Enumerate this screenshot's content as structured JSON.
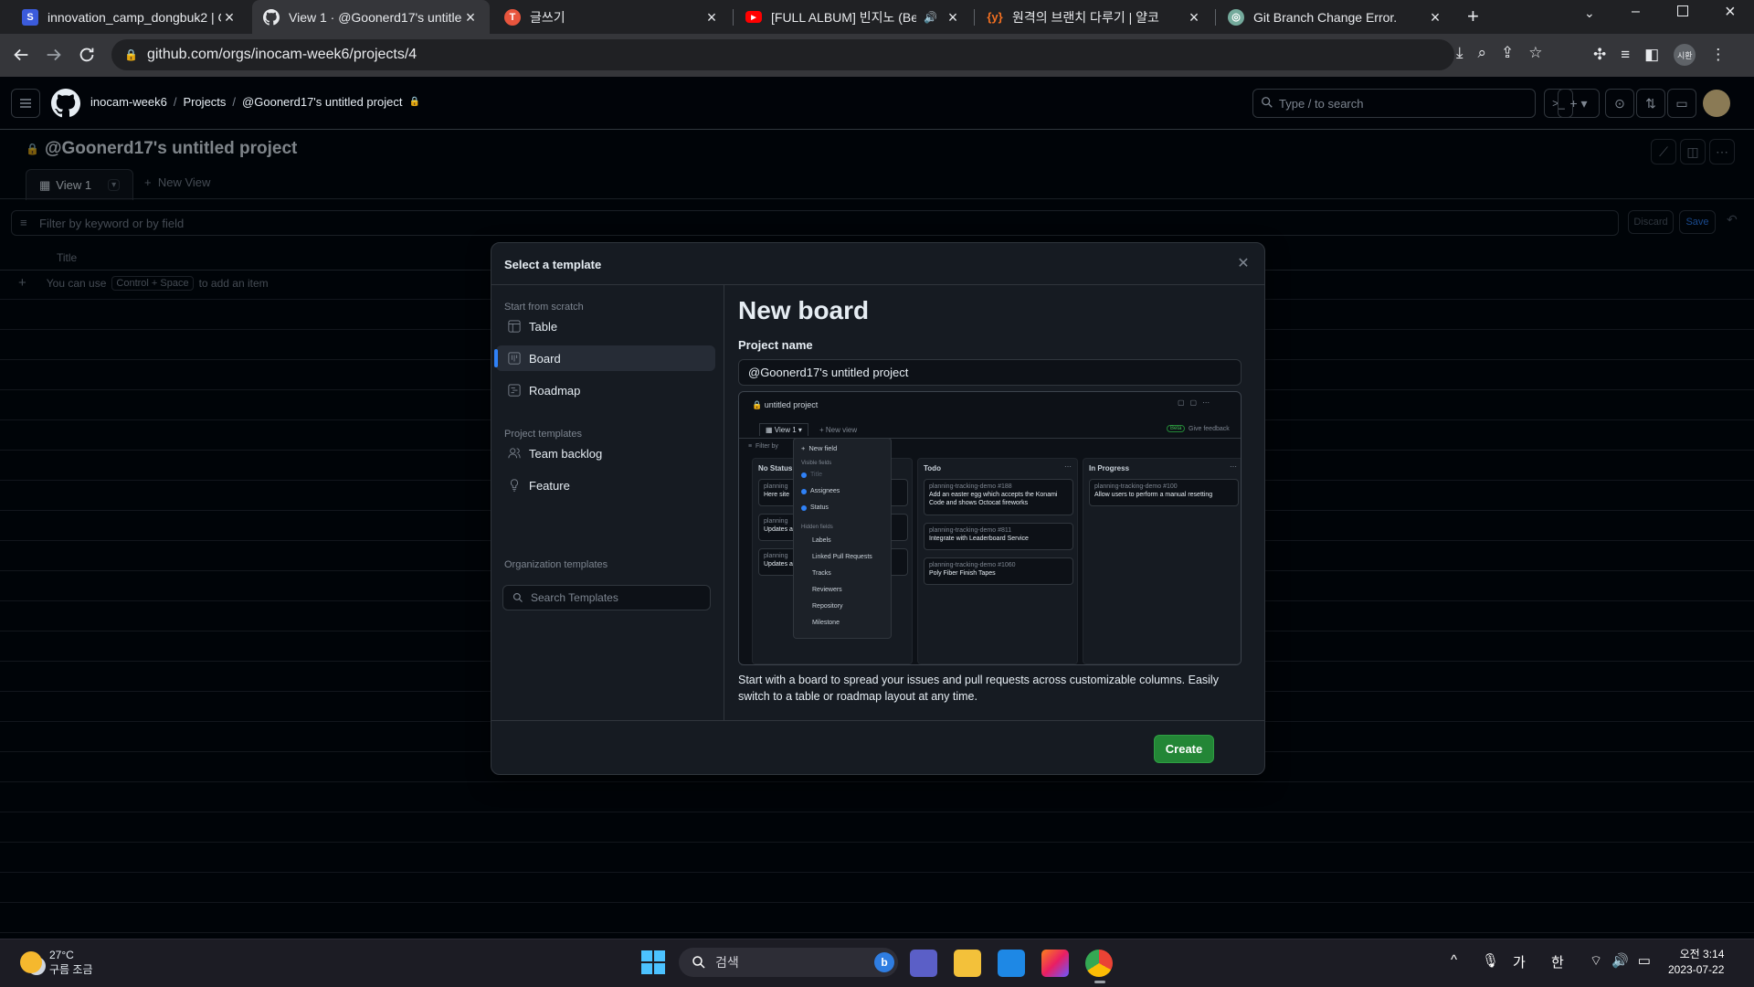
{
  "browser": {
    "tabs": [
      {
        "title": "innovation_camp_dongbuk2 | G",
        "icon": "brand-square-icon",
        "color": "#3b5bdb"
      },
      {
        "title": "View 1 · @Goonerd17's untitled",
        "icon": "github-icon",
        "active": true
      },
      {
        "title": "글쓰기",
        "icon": "tistory-icon",
        "color": "#e8553d"
      },
      {
        "title": "[FULL ALBUM] 빈지노 (Been",
        "icon": "youtube-icon",
        "color": "#ff0000"
      },
      {
        "title": "원격의 브랜치 다루기 | 얄코",
        "icon": "yalco-icon",
        "color": "#f37021"
      },
      {
        "title": "Git Branch Change Error.",
        "icon": "chatgpt-icon",
        "color": "#74aa9c"
      }
    ],
    "url": "github.com/orgs/inocam-week6/projects/4"
  },
  "github": {
    "breadcrumb": [
      "inocam-week6",
      "Projects",
      "@Goonerd17's untitled project"
    ],
    "search_placeholder": "Type / to search",
    "project_title": "@Goonerd17's untitled project",
    "view_tab": "View 1",
    "new_view": "New View",
    "filter_placeholder": "Filter by keyword or by field",
    "discard": "Discard",
    "save": "Save",
    "column_title": "Title",
    "add_hint_pre": "You can use",
    "add_hint_key": "Control + Space",
    "add_hint_post": "to add an item"
  },
  "dialog": {
    "heading": "Select a template",
    "sections": {
      "scratch": "Start from scratch",
      "project_templates": "Project templates",
      "org_templates": "Organization templates"
    },
    "scratch_items": [
      {
        "label": "Table",
        "icon": "table-icon"
      },
      {
        "label": "Board",
        "icon": "board-icon",
        "selected": true
      },
      {
        "label": "Roadmap",
        "icon": "roadmap-icon"
      }
    ],
    "template_items": [
      {
        "label": "Team backlog",
        "icon": "people-icon"
      },
      {
        "label": "Feature",
        "icon": "feature-icon"
      }
    ],
    "search_placeholder": "Search Templates",
    "board_title": "New board",
    "project_name_label": "Project name",
    "project_name_value": "@Goonerd17's untitled project",
    "description": "Start with a board to spread your issues and pull requests across customizable columns. Easily switch to a table or roadmap layout at any time.",
    "create": "Create",
    "preview": {
      "title": "untitled project",
      "view": "View 1",
      "new_view": "New view",
      "badge": "Beta",
      "feedback": "Give feedback",
      "filter": "Filter by",
      "menu": {
        "new_field": "New field",
        "visible_label": "Visible fields",
        "visible": [
          "Title",
          "Assignees",
          "Status"
        ],
        "hidden_label": "Hidden fields",
        "hidden": [
          "Labels",
          "Linked Pull Requests",
          "Tracks",
          "Reviewers",
          "Repository",
          "Milestone"
        ]
      },
      "columns": [
        {
          "name": "No Status",
          "cards": [
            {
              "meta": "planning",
              "text": "Here site"
            },
            {
              "meta": "planning",
              "text": "Updates a"
            },
            {
              "meta": "planning",
              "text": "Updates a"
            }
          ]
        },
        {
          "name": "Todo",
          "cards": [
            {
              "meta": "planning-tracking-demo #188",
              "text": "Add an easter egg which accepts the Konami Code and shows Octocat fireworks"
            },
            {
              "meta": "planning-tracking-demo #811",
              "text": "Integrate with Leaderboard Service"
            },
            {
              "meta": "planning-tracking-demo #1060",
              "text": "Poly Fiber Finish Tapes"
            }
          ]
        },
        {
          "name": "In Progress",
          "cards": [
            {
              "meta": "planning-tracking-demo #100",
              "text": "Allow users to perform a manual resetting"
            }
          ]
        }
      ]
    }
  },
  "taskbar": {
    "temperature": "27°C",
    "weather": "구름 조금",
    "search": "검색",
    "ime1": "가",
    "ime2": "한",
    "time": "오전 3:14",
    "date": "2023-07-22"
  },
  "colors": {
    "accent": "#2f81f7",
    "create": "#238636",
    "bg": "#010409"
  }
}
